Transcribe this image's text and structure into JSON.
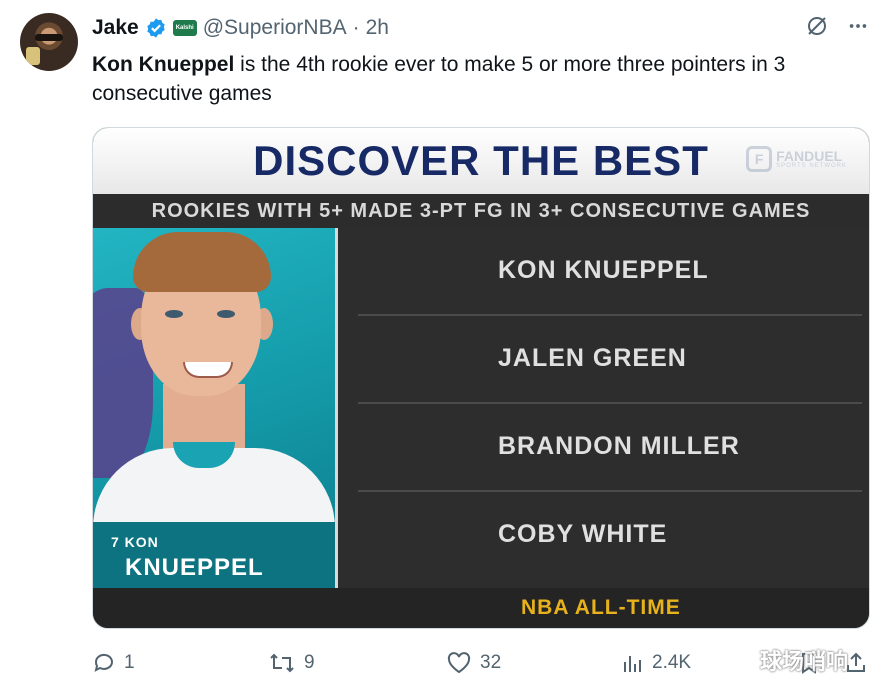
{
  "tweet": {
    "author_name": "Jake",
    "badge_label": "Kalshi",
    "handle": "@SuperiorNBA",
    "separator": "·",
    "time": "2h",
    "text_bold": "Kon Knueppel",
    "text_rest": " is the 4th rookie ever to make 5 or more three pointers in 3 consecutive games"
  },
  "graphic": {
    "title": "DISCOVER THE BEST",
    "logo_word": "FANDUEL",
    "logo_sub": "SPORTS NETWORK",
    "subtitle": "ROOKIES WITH 5+ MADE 3-PT FG IN 3+ CONSECUTIVE GAMES",
    "player_number": "7 KON",
    "player_last_name": "KNUEPPEL",
    "players": [
      "KON KNUEPPEL",
      "JALEN GREEN",
      "BRANDON MILLER",
      "COBY WHITE"
    ],
    "footer": "NBA ALL-TIME"
  },
  "actions": {
    "replies": "1",
    "reposts": "9",
    "likes": "32",
    "views": "2.4K"
  },
  "watermark": "球场哨响",
  "icons": [
    "verified-icon",
    "grok-icon",
    "more-icon",
    "reply-icon",
    "repost-icon",
    "like-icon",
    "views-icon",
    "bookmark-icon",
    "share-icon"
  ]
}
